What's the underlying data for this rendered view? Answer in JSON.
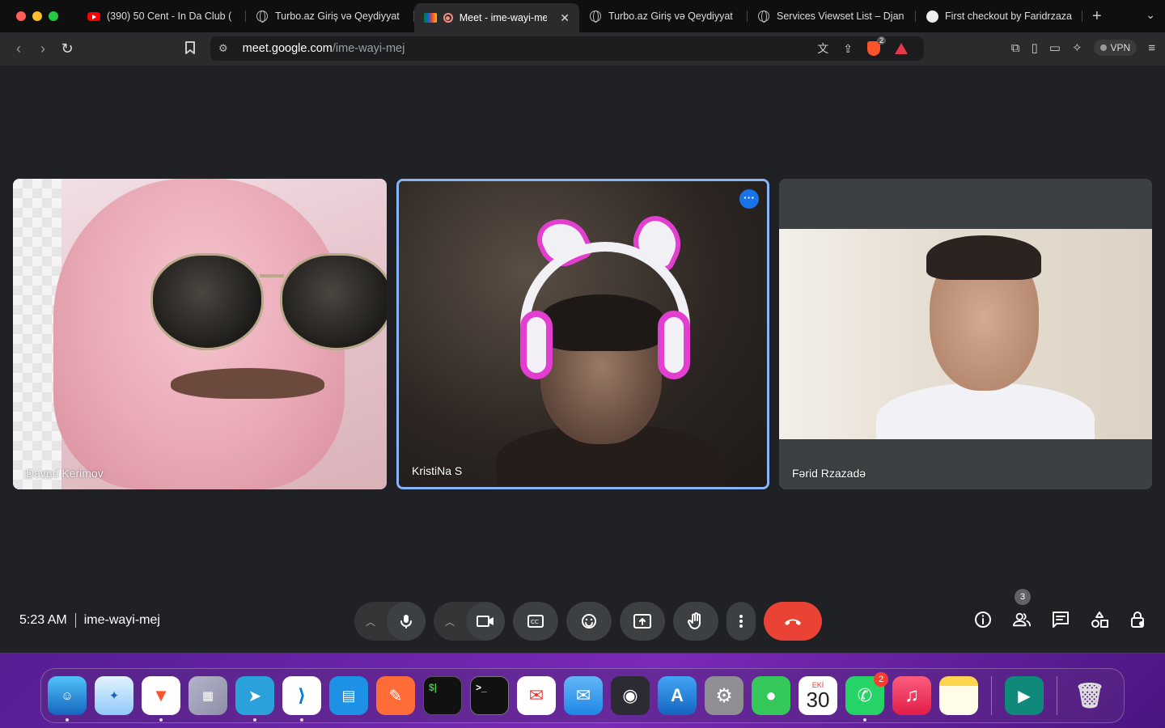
{
  "browser": {
    "tabs": [
      {
        "title": "(390) 50 Cent - In Da Club (",
        "icon": "youtube-icon",
        "active": false
      },
      {
        "title": "Turbo.az Giriş və Qeydiyyat",
        "icon": "globe-icon",
        "active": false
      },
      {
        "title": "Meet - ime-wayi-mej",
        "icon": "google-meet-icon",
        "active": true,
        "recording": true
      },
      {
        "title": "Turbo.az Giriş və Qeydiyyat",
        "icon": "globe-icon",
        "active": false
      },
      {
        "title": "Services Viewset List – Djan",
        "icon": "globe-icon",
        "active": false
      },
      {
        "title": "First checkout by Faridrzaza",
        "icon": "github-icon",
        "active": false
      }
    ],
    "url_host": "meet.google.com",
    "url_path": "/ime-wayi-mej",
    "brave_shield_count": "2",
    "vpn_label": "VPN"
  },
  "meet": {
    "participants": [
      {
        "name": "Davud Kerimov"
      },
      {
        "name": "KristiNa S",
        "speaking": true
      },
      {
        "name": "Fərid Rzazadə"
      }
    ],
    "time": "5:23 AM",
    "meeting_code": "ime-wayi-mej",
    "people_count": "3",
    "colors": {
      "end_call": "#ea4335",
      "active_border": "#8ab4f8",
      "background": "#202124"
    }
  },
  "dock": {
    "apps": [
      {
        "name": "finder",
        "icon": "finder-icon",
        "running": true
      },
      {
        "name": "safari",
        "icon": "safari-icon",
        "running": false
      },
      {
        "name": "brave",
        "icon": "brave-icon",
        "running": true
      },
      {
        "name": "launchpad",
        "icon": "launchpad-icon",
        "running": false
      },
      {
        "name": "telegram",
        "icon": "telegram-icon",
        "running": true
      },
      {
        "name": "vscode",
        "icon": "vscode-icon",
        "running": true
      },
      {
        "name": "docker",
        "icon": "docker-icon",
        "running": false
      },
      {
        "name": "postman",
        "icon": "postman-icon",
        "running": false
      },
      {
        "name": "iterm",
        "icon": "iterm-icon",
        "running": false,
        "glyph": "$|"
      },
      {
        "name": "terminal",
        "icon": "terminal-icon",
        "running": false,
        "glyph": ">_"
      },
      {
        "name": "mail-alt",
        "icon": "airmail-icon",
        "running": false
      },
      {
        "name": "mail",
        "icon": "mail-icon",
        "running": false
      },
      {
        "name": "obs",
        "icon": "obs-icon",
        "running": false
      },
      {
        "name": "app-store",
        "icon": "app-store-icon",
        "running": false
      },
      {
        "name": "system-settings",
        "icon": "settings-icon",
        "running": false
      },
      {
        "name": "messages",
        "icon": "messages-icon",
        "running": false
      },
      {
        "name": "calendar",
        "icon": "calendar-icon",
        "running": false,
        "month": "EKİ",
        "day": "30"
      },
      {
        "name": "whatsapp",
        "icon": "whatsapp-icon",
        "running": true,
        "badge": "2"
      },
      {
        "name": "music",
        "icon": "music-icon",
        "running": false
      },
      {
        "name": "notes",
        "icon": "notes-icon",
        "running": false
      },
      {
        "name": "google-meet",
        "icon": "google-meet-app-icon",
        "running": false
      },
      {
        "name": "trash",
        "icon": "trash-icon",
        "running": false
      }
    ]
  }
}
